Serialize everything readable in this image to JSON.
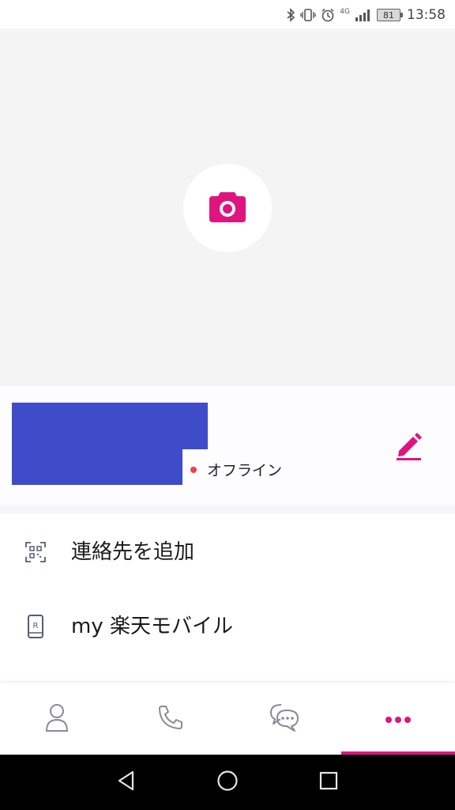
{
  "status_bar": {
    "network": "4G",
    "battery": "81",
    "time": "13:58"
  },
  "profile": {
    "presence": "オフライン"
  },
  "menu": [
    {
      "label": "連絡先を追加",
      "icon": "qr-code-icon"
    },
    {
      "label": "my 楽天モバイル",
      "icon": "rakuten-phone-icon"
    }
  ],
  "bottom_nav": {
    "tabs": [
      "contacts-icon",
      "phone-icon",
      "chat-icon",
      "more-icon"
    ],
    "active_tab": "more"
  },
  "colors": {
    "accent": "#e0147f",
    "redaction": "#3f4cc9",
    "offline_dot": "#e8454b"
  }
}
